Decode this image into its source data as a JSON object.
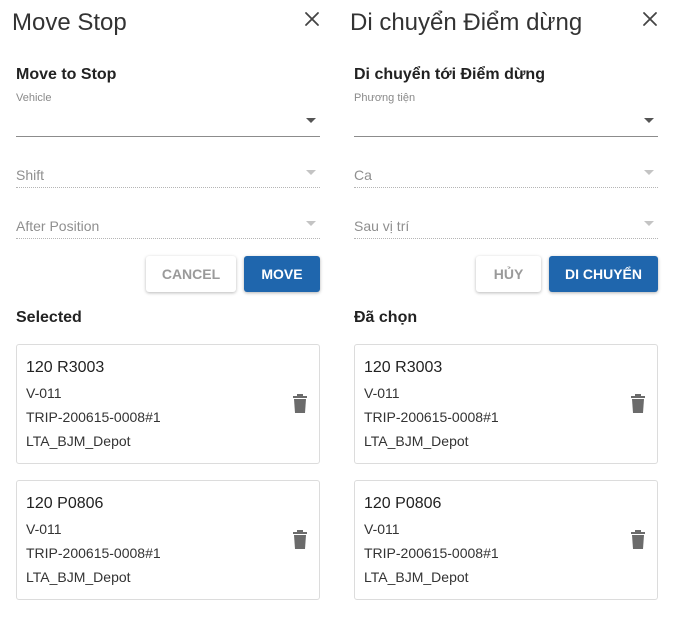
{
  "colors": {
    "primary": "#1f66ad",
    "icon": "#6b6b6b"
  },
  "panels": [
    {
      "lang": "en",
      "title": "Move Stop",
      "subtitle": "Move to Stop",
      "vehicle_label": "Vehicle",
      "shift_placeholder": "Shift",
      "after_position_placeholder": "After Position",
      "cancel_label": "CANCEL",
      "move_label": "MOVE",
      "selected_heading": "Selected",
      "items": [
        {
          "code": "120 R3003",
          "vehicle": "V-011",
          "trip": "TRIP-200615-0008#1",
          "depot": "LTA_BJM_Depot"
        },
        {
          "code": "120 P0806",
          "vehicle": "V-011",
          "trip": "TRIP-200615-0008#1",
          "depot": "LTA_BJM_Depot"
        }
      ]
    },
    {
      "lang": "vi",
      "title": "Di chuyển Điểm dừng",
      "subtitle": "Di chuyển tới Điểm dừng",
      "vehicle_label": "Phương tiện",
      "shift_placeholder": "Ca",
      "after_position_placeholder": "Sau vị trí",
      "cancel_label": "HỦY",
      "move_label": "DI CHUYỂN",
      "selected_heading": "Đã chọn",
      "items": [
        {
          "code": "120 R3003",
          "vehicle": "V-011",
          "trip": "TRIP-200615-0008#1",
          "depot": "LTA_BJM_Depot"
        },
        {
          "code": "120 P0806",
          "vehicle": "V-011",
          "trip": "TRIP-200615-0008#1",
          "depot": "LTA_BJM_Depot"
        }
      ]
    }
  ]
}
